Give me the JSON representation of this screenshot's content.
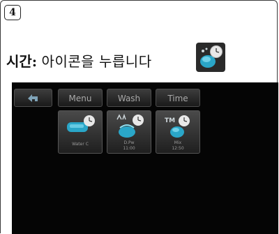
{
  "step": {
    "number": "4"
  },
  "instruction": {
    "label": "시간:",
    "text": "아이콘을 누릅니다"
  },
  "screen": {
    "toolbar": {
      "menu_label": "Menu",
      "wash_label": "Wash",
      "time_label": "Time"
    },
    "tiles": [
      {
        "icon": "water-tap-clock-icon",
        "line1": "Water C",
        "line2": ""
      },
      {
        "icon": "wash-cycle-clock-icon",
        "line1": "D.Pw",
        "line2": "11:00"
      },
      {
        "icon": "tm-clock-icon",
        "line1": "Mix",
        "line2": "12:50"
      }
    ]
  },
  "colors": {
    "screen_bg": "#050505",
    "button_text": "#a9a9a9",
    "icon_accent": "#39b8d6"
  }
}
